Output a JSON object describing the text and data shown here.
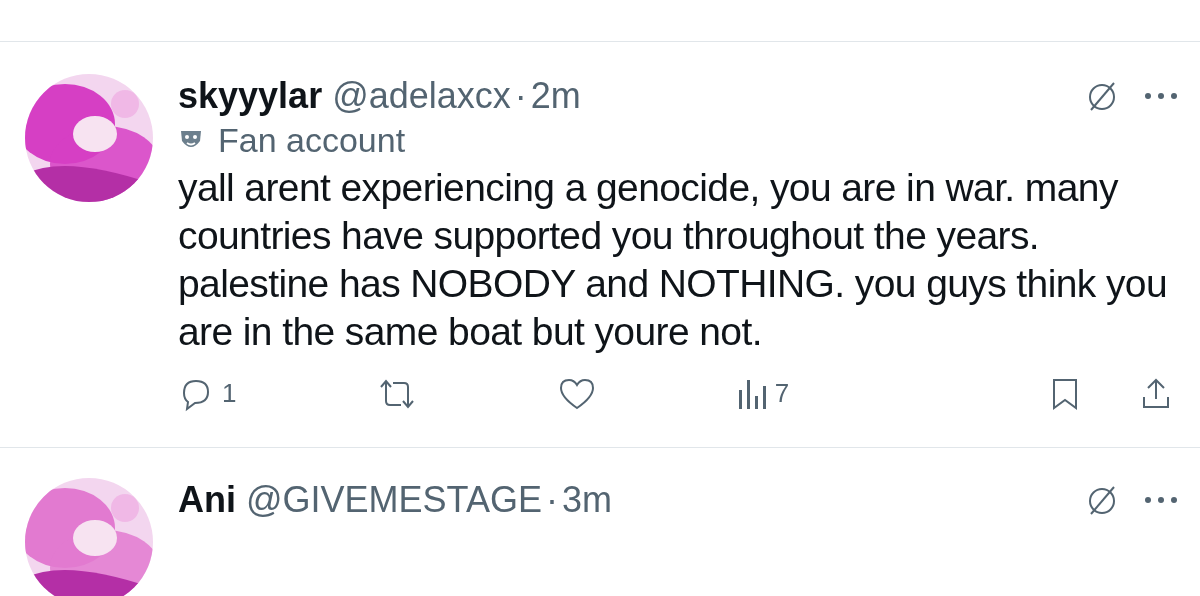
{
  "tweets": [
    {
      "name": "skyyylar",
      "handle": "@adelaxcx",
      "separator": "·",
      "time": "2m",
      "label": "Fan account",
      "text": "yall arent experiencing a genocide, you are in war. many countries have supported you throughout the years. palestine has NOBODY and NOTHING. you guys think you are in the same boat but youre not.",
      "replies": "1",
      "views": "7"
    },
    {
      "name": "Ani",
      "handle": "@GIVEMESTAGE",
      "separator": "·",
      "time": "3m"
    }
  ]
}
